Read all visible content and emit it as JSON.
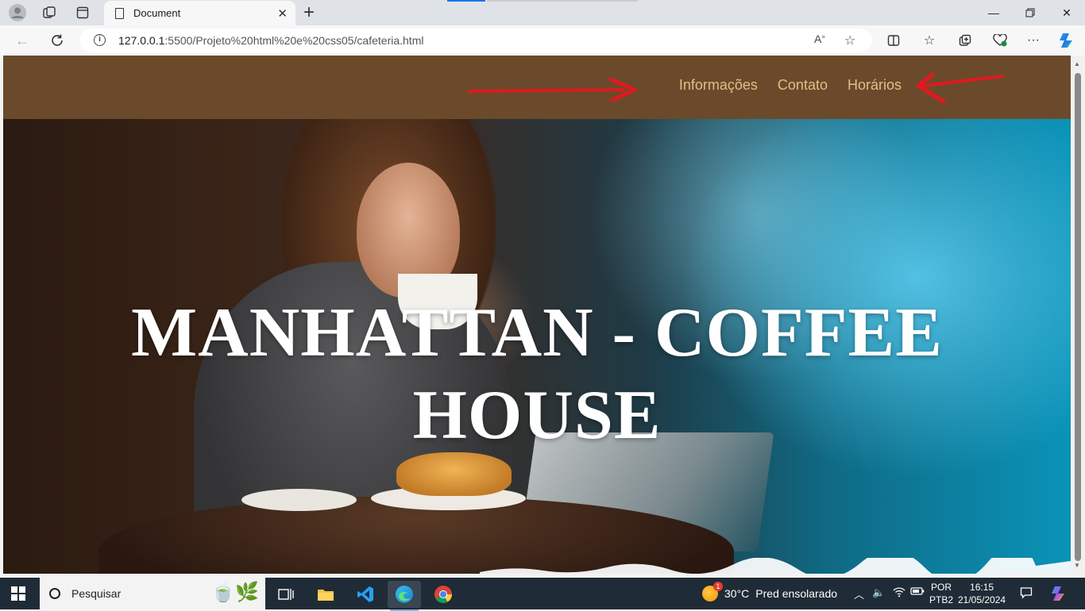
{
  "browser": {
    "tab_title": "Document",
    "url_host": "127.0.0.1",
    "url_rest": ":5500/Projeto%20html%20e%20css05/cafeteria.html"
  },
  "site": {
    "nav": [
      "Informações",
      "Contato",
      "Horários"
    ],
    "hero_title_line1": "MANHATTAN - COFFEE",
    "hero_title_line2": "HOUSE"
  },
  "taskbar": {
    "search_label": "Pesquisar",
    "weather_temp": "30°C",
    "weather_desc": "Pred ensolarado",
    "weather_badge": "1",
    "lang_top": "POR",
    "lang_bottom": "PTB2",
    "time": "16:15",
    "date": "21/05/2024"
  },
  "colors": {
    "header_bg": "#6b4a2b",
    "nav_text": "#e2bd8a",
    "annotation_arrow": "#e0191f"
  }
}
